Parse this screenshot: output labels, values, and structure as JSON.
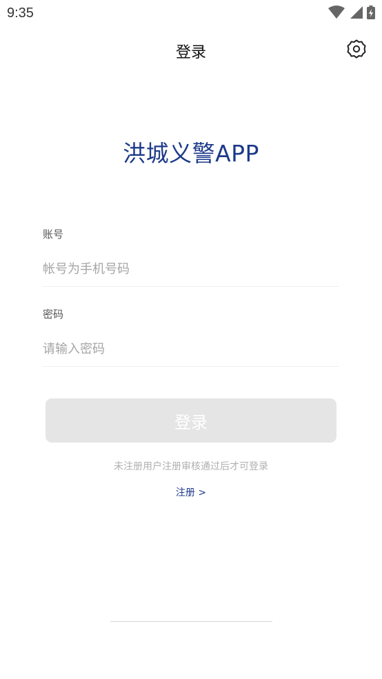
{
  "status_bar": {
    "time": "9:35",
    "icons": [
      "wifi-icon",
      "cellular-signal-icon",
      "battery-charging-icon"
    ]
  },
  "app_bar": {
    "title": "登录",
    "settings_icon": "gear-icon"
  },
  "app_name": "洪城义警APP",
  "form": {
    "account": {
      "label": "账号",
      "placeholder": "帐号为手机号码",
      "value": ""
    },
    "password": {
      "label": "密码",
      "placeholder": "请输入密码",
      "value": ""
    }
  },
  "login_button": {
    "label": "登录",
    "enabled": false
  },
  "hint": "未注册用户注册审核通过后才可登录",
  "register_link": "注册 >",
  "colors": {
    "brand": "#1d3a8a",
    "button_disabled": "#e5e5e5",
    "hint": "#b0b0b0",
    "placeholder": "#a5a5a5"
  }
}
